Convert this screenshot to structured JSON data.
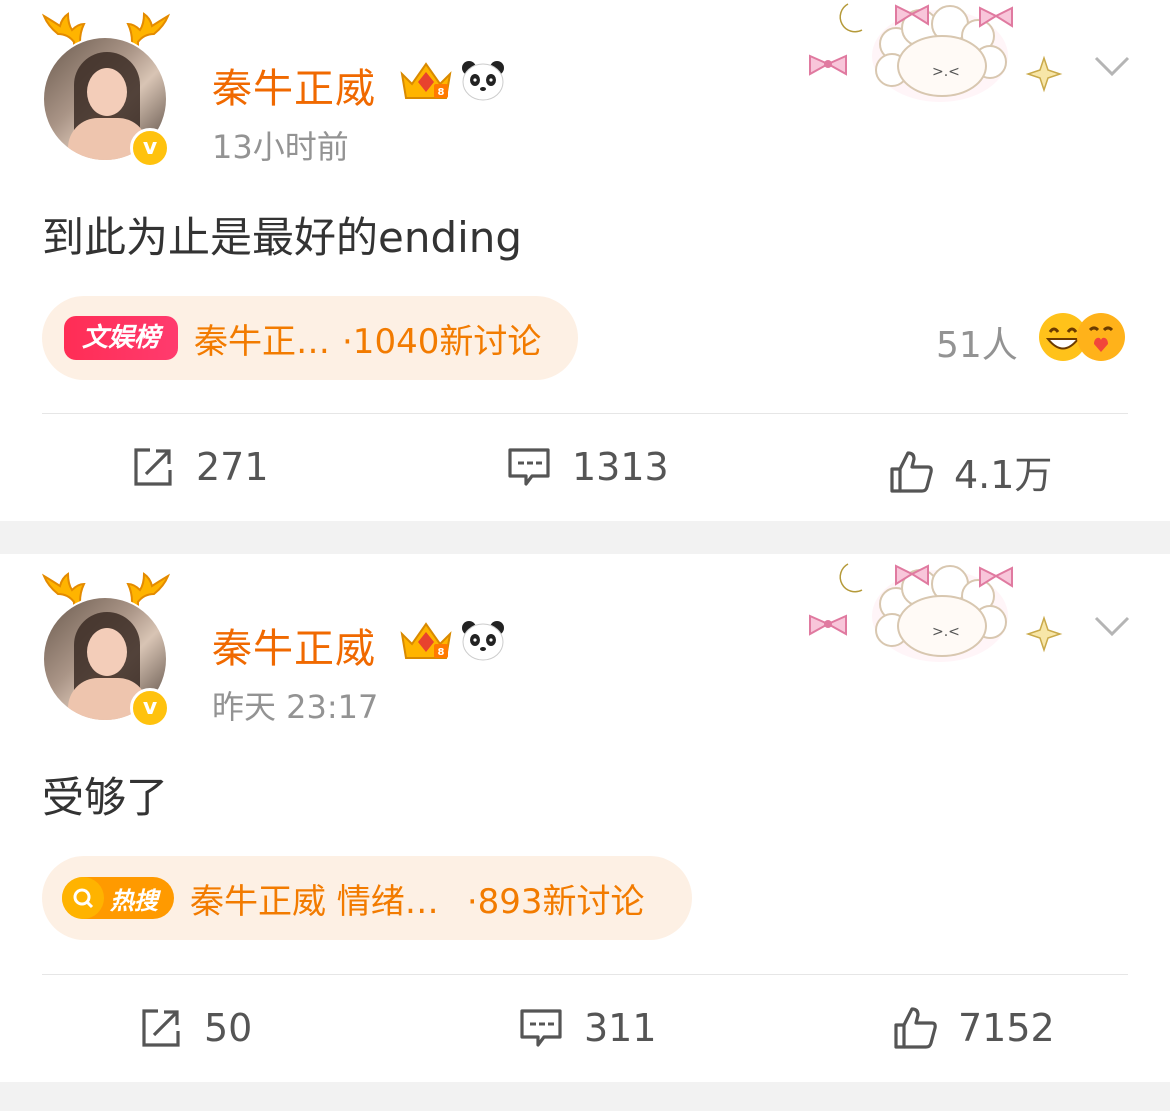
{
  "posts": [
    {
      "author": "秦牛正威",
      "time": "13小时前",
      "content": "到此为止是最好的ending",
      "topic": {
        "tag": "文娱榜",
        "text": "秦牛正…",
        "count": "·1040新讨论"
      },
      "reactions": "51人",
      "actions": {
        "repost": "271",
        "comment": "1313",
        "like": "4.1万"
      }
    },
    {
      "author": "秦牛正威",
      "time": "昨天 23:17",
      "content": "受够了",
      "topic": {
        "tag": "热搜",
        "text": "秦牛正威 情绪…",
        "count": "·893新讨论"
      },
      "actions": {
        "repost": "50",
        "comment": "311",
        "like": "7152"
      }
    }
  ],
  "colors": {
    "name": "#f06900",
    "topic_text": "#f27b00",
    "topic_bg": "#fdf0e4",
    "verified": "#ffc20e",
    "meta": "#939393"
  },
  "icons": [
    "deer-antler-icon",
    "verified-v-icon",
    "crown-badge-icon",
    "panda-icon",
    "decor-sticker-icon",
    "chevron-down-icon",
    "search-icon",
    "repost-icon",
    "comment-icon",
    "like-icon"
  ]
}
